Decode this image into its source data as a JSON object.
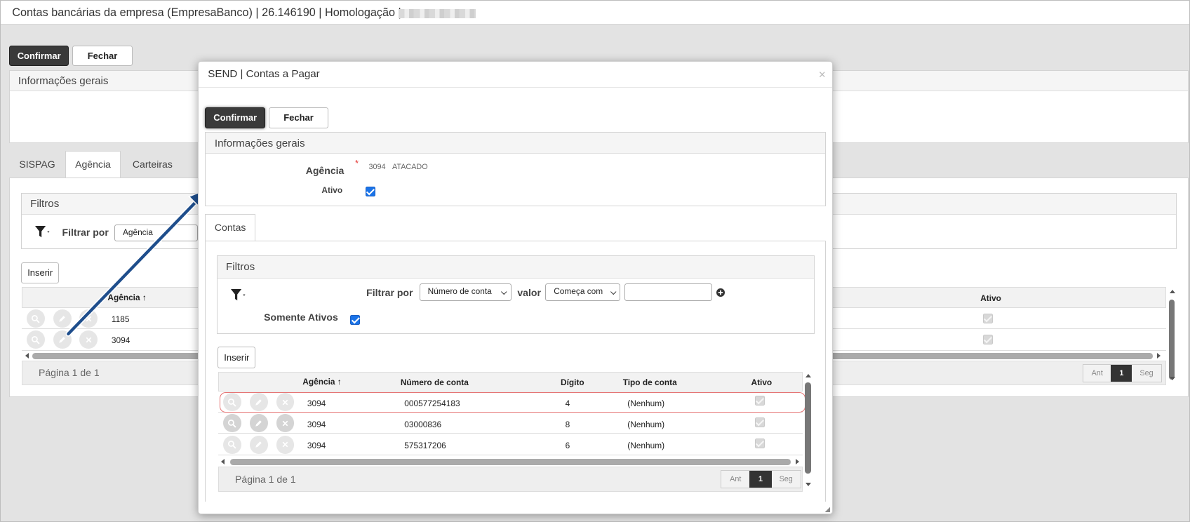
{
  "window": {
    "title": "Contas bancárias da empresa (EmpresaBanco) | 26.146190 | Homologação |"
  },
  "background": {
    "toolbar": {
      "confirm": "Confirmar",
      "close": "Fechar"
    },
    "general_info": {
      "title": "Informações gerais"
    },
    "tabs": [
      "SISPAG",
      "Agência",
      "Carteiras"
    ],
    "filters": {
      "title": "Filtros",
      "filter_by": "Filtrar por",
      "filter_field": "Agência"
    },
    "insert": "Inserir",
    "grid": {
      "col_agencia": "Agência",
      "col_ativo": "Ativo",
      "rows": [
        {
          "agencia": "1185"
        },
        {
          "agencia": "3094"
        }
      ]
    },
    "pagination": {
      "label": "Página 1 de 1",
      "prev": "Ant",
      "page": "1",
      "next": "Seg"
    }
  },
  "modal": {
    "title": "SEND | Contas a Pagar",
    "close_symbol": "×",
    "toolbar": {
      "confirm": "Confirmar",
      "close": "Fechar"
    },
    "general_info": {
      "title": "Informações gerais",
      "agencia_label": "Agência",
      "required_mark": "*",
      "agencia_code": "3094",
      "agencia_name": "ATACADO",
      "ativo_label": "Ativo",
      "ativo_checked": true
    },
    "tab": "Contas",
    "filters": {
      "title": "Filtros",
      "filter_by": "Filtrar por",
      "field_value": "Número de conta",
      "valor_label": "valor",
      "operator_value": "Começa com",
      "search_value": "",
      "only_active_label": "Somente Ativos",
      "only_active_checked": true
    },
    "insert": "Inserir",
    "grid": {
      "headers": {
        "agencia": "Agência",
        "numero": "Número de conta",
        "digito": "Dígito",
        "tipo": "Tipo de conta",
        "ativo": "Ativo"
      },
      "rows": [
        {
          "agencia": "3094",
          "numero": "000577254183",
          "digito": "4",
          "tipo": "(Nenhum)",
          "ativo": true,
          "highlighted": true
        },
        {
          "agencia": "3094",
          "numero": "03000836",
          "digito": "8",
          "tipo": "(Nenhum)",
          "ativo": true,
          "highlighted": false
        },
        {
          "agencia": "3094",
          "numero": "575317206",
          "digito": "6",
          "tipo": "(Nenhum)",
          "ativo": true,
          "highlighted": false
        }
      ]
    },
    "pagination": {
      "label": "Página 1 de 1",
      "prev": "Ant",
      "page": "1",
      "next": "Seg"
    }
  },
  "colors": {
    "dark_button": "#3a3a3a",
    "highlight_border": "#e57373",
    "arrow": "#1f4e8c",
    "checkbox_blue": "#1a73e8"
  }
}
